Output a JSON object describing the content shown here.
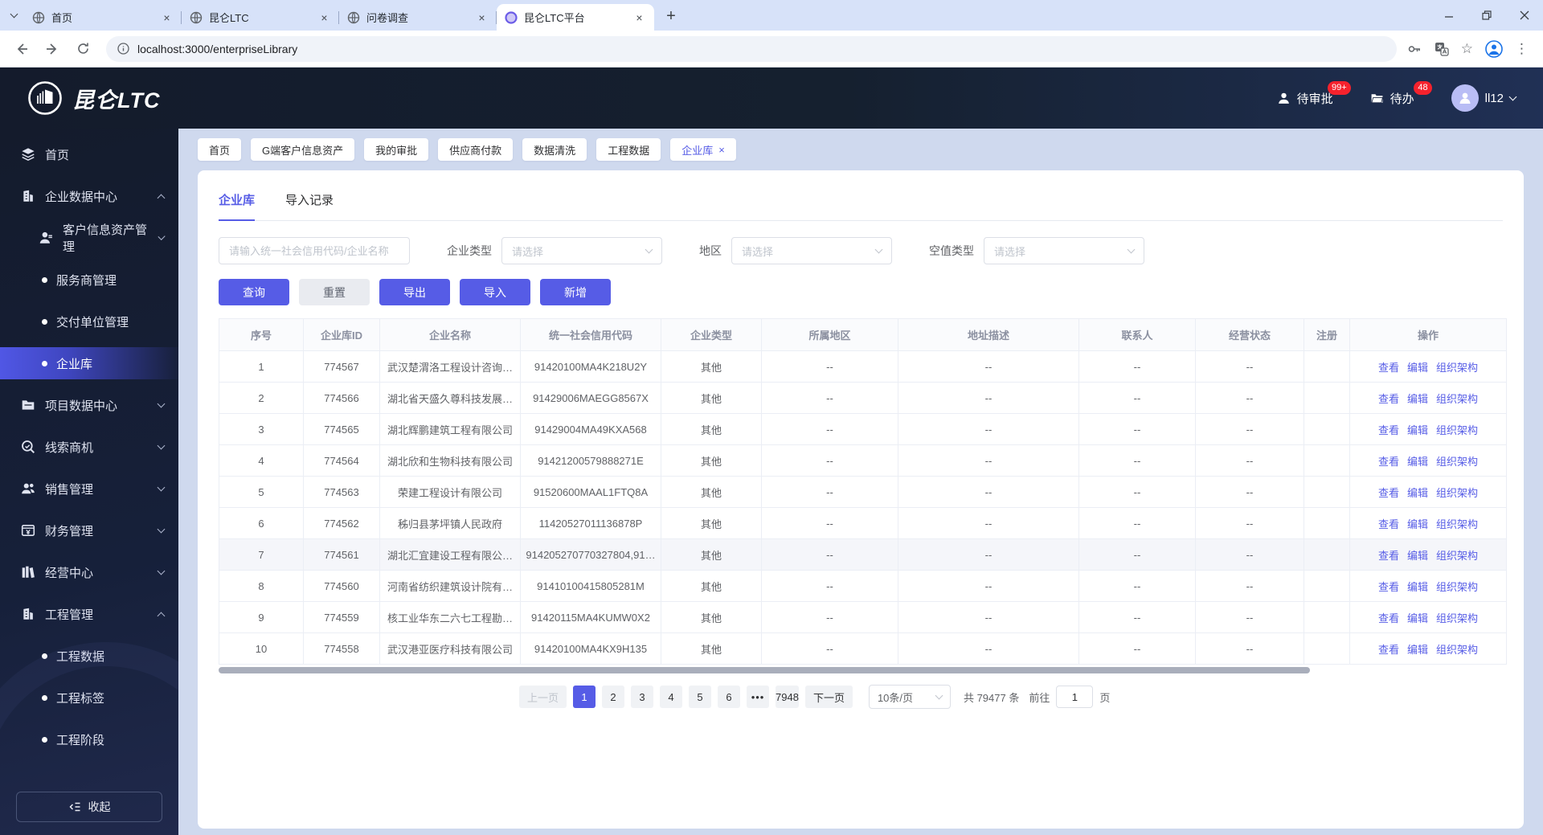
{
  "colors": {
    "accent": "#565CE6",
    "badge_red": "#F5222D",
    "header_navy": "#141B2C",
    "page_bg": "#CFD9EE"
  },
  "browser": {
    "tabs": [
      {
        "title": "首页",
        "favicon": "globe",
        "active": false
      },
      {
        "title": "昆仑LTC",
        "favicon": "globe",
        "active": false
      },
      {
        "title": "问卷调查",
        "favicon": "globe",
        "active": false
      },
      {
        "title": "昆仑LTC平台",
        "favicon": "app",
        "active": true
      }
    ],
    "url": "localhost:3000/enterpriseLibrary"
  },
  "header": {
    "logo_text": "昆仑LTC",
    "pending_approval": {
      "label": "待审批",
      "badge": "99+"
    },
    "todo": {
      "label": "待办",
      "badge": "48"
    },
    "username": "ll12"
  },
  "sidebar": {
    "items": [
      {
        "label": "首页",
        "icon": "layers",
        "type": "top",
        "expandable": false
      },
      {
        "label": "企业数据中心",
        "icon": "building",
        "type": "top",
        "expandable": true,
        "expanded": true
      },
      {
        "label": "客户信息资产管理",
        "icon": "person",
        "type": "group",
        "expandable": true,
        "expanded": false
      },
      {
        "label": "服务商管理",
        "type": "leaf"
      },
      {
        "label": "交付单位管理",
        "type": "leaf"
      },
      {
        "label": "企业库",
        "type": "leaf",
        "active": true
      },
      {
        "label": "项目数据中心",
        "icon": "folder",
        "type": "top",
        "expandable": true,
        "expanded": false
      },
      {
        "label": "线索商机",
        "icon": "search",
        "type": "top",
        "expandable": true,
        "expanded": false
      },
      {
        "label": "销售管理",
        "icon": "people",
        "type": "top",
        "expandable": true,
        "expanded": false
      },
      {
        "label": "财务管理",
        "icon": "wallet",
        "type": "top",
        "expandable": true,
        "expanded": false
      },
      {
        "label": "经营中心",
        "icon": "books",
        "type": "top",
        "expandable": true,
        "expanded": false
      },
      {
        "label": "工程管理",
        "icon": "building2",
        "type": "top",
        "expandable": true,
        "expanded": true
      },
      {
        "label": "工程数据",
        "type": "leaf"
      },
      {
        "label": "工程标签",
        "type": "leaf"
      },
      {
        "label": "工程阶段",
        "type": "leaf"
      }
    ],
    "collapse_label": "收起"
  },
  "tagbar": [
    {
      "label": "首页",
      "active": false
    },
    {
      "label": "G端客户信息资产",
      "active": false
    },
    {
      "label": "我的审批",
      "active": false
    },
    {
      "label": "供应商付款",
      "active": false
    },
    {
      "label": "数据清洗",
      "active": false
    },
    {
      "label": "工程数据",
      "active": false
    },
    {
      "label": "企业库",
      "active": true,
      "closable": true
    }
  ],
  "main": {
    "tabs": [
      {
        "label": "企业库",
        "active": true
      },
      {
        "label": "导入记录",
        "active": false
      }
    ],
    "filters": {
      "search_placeholder": "请输入统一社会信用代码/企业名称",
      "company_type_label": "企业类型",
      "region_label": "地区",
      "empty_type_label": "空值类型",
      "select_placeholder": "请选择"
    },
    "actions": {
      "query": "查询",
      "reset": "重置",
      "export": "导出",
      "import": "导入",
      "add": "新增"
    },
    "table": {
      "columns": [
        "序号",
        "企业库ID",
        "企业名称",
        "统一社会信用代码",
        "企业类型",
        "所属地区",
        "地址描述",
        "联系人",
        "经营状态",
        "注册",
        "操作"
      ],
      "action_labels": [
        "查看",
        "编辑",
        "组织架构"
      ],
      "rows": [
        {
          "index": "1",
          "id": "774567",
          "name": "武汉楚渭洛工程设计咨询…",
          "code": "91420100MA4K218U2Y",
          "type": "其他",
          "region": "--",
          "address": "--",
          "contact": "--",
          "status": "--",
          "reg": "",
          "highlighted": false
        },
        {
          "index": "2",
          "id": "774566",
          "name": "湖北省天盛久尊科技发展…",
          "code": "91429006MAEGG8567X",
          "type": "其他",
          "region": "--",
          "address": "--",
          "contact": "--",
          "status": "--",
          "reg": "",
          "highlighted": false
        },
        {
          "index": "3",
          "id": "774565",
          "name": "湖北辉鹏建筑工程有限公司",
          "code": "91429004MA49KXA568",
          "type": "其他",
          "region": "--",
          "address": "--",
          "contact": "--",
          "status": "--",
          "reg": "",
          "highlighted": false
        },
        {
          "index": "4",
          "id": "774564",
          "name": "湖北欣和生物科技有限公司",
          "code": "91421200579888271E",
          "type": "其他",
          "region": "--",
          "address": "--",
          "contact": "--",
          "status": "--",
          "reg": "",
          "highlighted": false
        },
        {
          "index": "5",
          "id": "774563",
          "name": "荣建工程设计有限公司",
          "code": "91520600MAAL1FTQ8A",
          "type": "其他",
          "region": "--",
          "address": "--",
          "contact": "--",
          "status": "--",
          "reg": "",
          "highlighted": false
        },
        {
          "index": "6",
          "id": "774562",
          "name": "秭归县茅坪镇人民政府",
          "code": "11420527011136878P",
          "type": "其他",
          "region": "--",
          "address": "--",
          "contact": "--",
          "status": "--",
          "reg": "",
          "highlighted": false
        },
        {
          "index": "7",
          "id": "774561",
          "name": "湖北汇宜建设工程有限公…",
          "code": "914205270770327804,91…",
          "type": "其他",
          "region": "--",
          "address": "--",
          "contact": "--",
          "status": "--",
          "reg": "",
          "highlighted": true
        },
        {
          "index": "8",
          "id": "774560",
          "name": "河南省纺织建筑设计院有…",
          "code": "91410100415805281M",
          "type": "其他",
          "region": "--",
          "address": "--",
          "contact": "--",
          "status": "--",
          "reg": "",
          "highlighted": false
        },
        {
          "index": "9",
          "id": "774559",
          "name": "核工业华东二六七工程勘…",
          "code": "91420115MA4KUMW0X2",
          "type": "其他",
          "region": "--",
          "address": "--",
          "contact": "--",
          "status": "--",
          "reg": "",
          "highlighted": false
        },
        {
          "index": "10",
          "id": "774558",
          "name": "武汉港亚医疗科技有限公司",
          "code": "91420100MA4KX9H135",
          "type": "其他",
          "region": "--",
          "address": "--",
          "contact": "--",
          "status": "--",
          "reg": "",
          "highlighted": false
        }
      ]
    },
    "pagination": {
      "prev": "上一页",
      "next": "下一页",
      "pages": [
        "1",
        "2",
        "3",
        "4",
        "5",
        "6",
        "•••",
        "7948"
      ],
      "active_page": "1",
      "page_size": "10条/页",
      "total": "共 79477 条",
      "goto_label": "前往",
      "goto_value": "1",
      "goto_suffix": "页"
    }
  }
}
